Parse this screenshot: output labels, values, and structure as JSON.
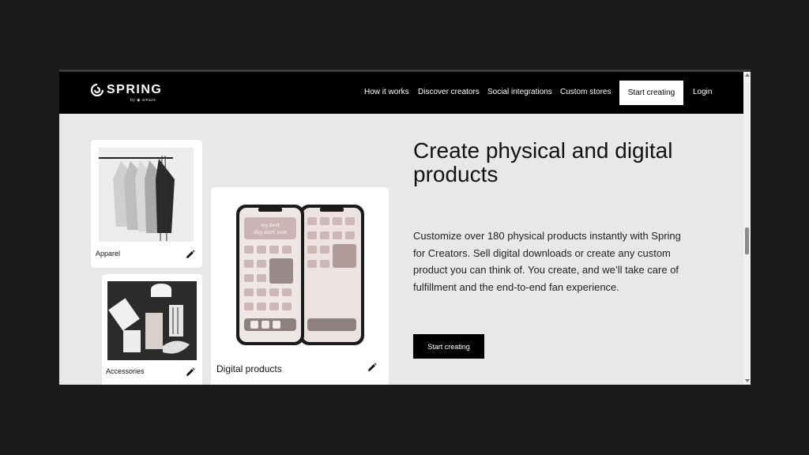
{
  "header": {
    "brand": "SPRING",
    "brand_by": "by ◉ amaze",
    "nav": [
      "How it works",
      "Discover creators",
      "Social integrations",
      "Custom stores"
    ],
    "cta_label": "Start creating",
    "login_label": "Login"
  },
  "products": {
    "apparel_label": "Apparel",
    "accessories_label": "Accessories",
    "digital_label": "Digital products",
    "phone_note": "my best day start now"
  },
  "hero": {
    "title": "Create physical and digital products",
    "body": "Customize over 180 physical products instantly with Spring for Creators. Sell digital downloads or create any custom product you can think of. You create, and we’ll take care of fulfillment and the end-to-end fan experience.",
    "cta_label": "Start creating"
  },
  "colors": {
    "navbar": "#000000",
    "page_bg": "#e8e8e8",
    "backdrop": "#1b1b1b"
  },
  "icons": [
    "spring-logo-icon",
    "pencil-icon",
    "scroll-up-icon",
    "scroll-down-icon"
  ]
}
